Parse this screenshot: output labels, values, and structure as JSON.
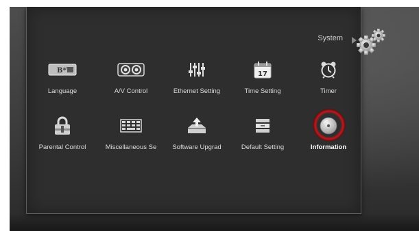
{
  "menu": {
    "section_title": "System",
    "items": [
      {
        "label": "Language",
        "icon": "language-icon"
      },
      {
        "label": "A/V Control",
        "icon": "av-control-icon"
      },
      {
        "label": "Ethernet Setting",
        "icon": "ethernet-setting-icon"
      },
      {
        "label": "Time Setting",
        "icon": "calendar-icon"
      },
      {
        "label": "Timer",
        "icon": "alarm-clock-icon"
      },
      {
        "label": "Parental Control",
        "icon": "lock-icon"
      },
      {
        "label": "Miscellaneous Se",
        "icon": "keyboard-icon"
      },
      {
        "label": "Software Upgrad",
        "icon": "upgrade-icon"
      },
      {
        "label": "Default Setting",
        "icon": "default-setting-icon"
      },
      {
        "label": "Information",
        "icon": "information-disc-icon"
      }
    ],
    "selected_index": 9,
    "calendar_day": "17",
    "language_icon_text": "B*T"
  },
  "colors": {
    "selection_ring": "#c8141a",
    "panel": "#2e2e2e"
  }
}
